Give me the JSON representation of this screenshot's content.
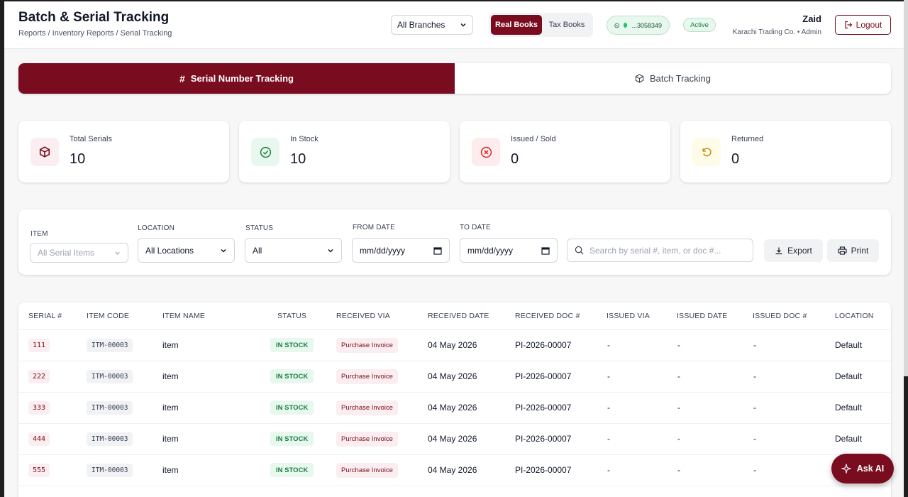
{
  "header": {
    "title": "Batch & Serial Tracking",
    "breadcrumb": "Reports / Inventory Reports / Serial Tracking",
    "branch_select": "All Branches",
    "books": {
      "real": "Real Books",
      "tax": "Tax Books"
    },
    "whatsapp": "...3058349",
    "status": "Active",
    "user_name": "Zaid",
    "user_org": "Karachi Trading Co. • Admin",
    "logout": "Logout"
  },
  "tabs": {
    "serial": "Serial Number Tracking",
    "batch": "Batch Tracking"
  },
  "stats": [
    {
      "label": "Total Serials",
      "value": "10"
    },
    {
      "label": "In Stock",
      "value": "10"
    },
    {
      "label": "Issued / Sold",
      "value": "0"
    },
    {
      "label": "Returned",
      "value": "0"
    }
  ],
  "filters": {
    "item_label": "ITEM",
    "item_placeholder": "All Serial Items",
    "location_label": "LOCATION",
    "location_value": "All Locations",
    "status_label": "STATUS",
    "status_value": "All",
    "from_label": "FROM DATE",
    "from_value": "mm/dd/yyyy",
    "to_label": "TO DATE",
    "to_value": "mm/dd/yyyy",
    "search_placeholder": "Search by serial #, item, or doc #...",
    "export": "Export",
    "print": "Print"
  },
  "table": {
    "columns": [
      "SERIAL #",
      "ITEM CODE",
      "ITEM NAME",
      "STATUS",
      "RECEIVED VIA",
      "RECEIVED DATE",
      "RECEIVED DOC #",
      "ISSUED VIA",
      "ISSUED DATE",
      "ISSUED DOC #",
      "LOCATION"
    ],
    "rows": [
      {
        "serial": "111",
        "code": "ITM-00003",
        "name": "item",
        "status": "IN STOCK",
        "via": "Purchase Invoice",
        "date": "04 May 2026",
        "doc": "PI-2026-00007",
        "issued_via": "-",
        "issued_date": "-",
        "issued_doc": "-",
        "location": "Default"
      },
      {
        "serial": "222",
        "code": "ITM-00003",
        "name": "item",
        "status": "IN STOCK",
        "via": "Purchase Invoice",
        "date": "04 May 2026",
        "doc": "PI-2026-00007",
        "issued_via": "-",
        "issued_date": "-",
        "issued_doc": "-",
        "location": "Default"
      },
      {
        "serial": "333",
        "code": "ITM-00003",
        "name": "item",
        "status": "IN STOCK",
        "via": "Purchase Invoice",
        "date": "04 May 2026",
        "doc": "PI-2026-00007",
        "issued_via": "-",
        "issued_date": "-",
        "issued_doc": "-",
        "location": "Default"
      },
      {
        "serial": "444",
        "code": "ITM-00003",
        "name": "item",
        "status": "IN STOCK",
        "via": "Purchase Invoice",
        "date": "04 May 2026",
        "doc": "PI-2026-00007",
        "issued_via": "-",
        "issued_date": "-",
        "issued_doc": "-",
        "location": "Default"
      },
      {
        "serial": "555",
        "code": "ITM-00003",
        "name": "item",
        "status": "IN STOCK",
        "via": "Purchase Invoice",
        "date": "04 May 2026",
        "doc": "PI-2026-00007",
        "issued_via": "-",
        "issued_date": "-",
        "issued_doc": "-",
        "location": ""
      }
    ]
  },
  "ask_ai": "Ask AI",
  "colors": {
    "brand": "#7a0c1f",
    "success": "#15803d"
  }
}
